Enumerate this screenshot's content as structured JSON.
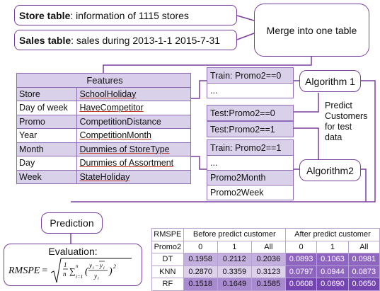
{
  "store_box": {
    "bold": "Store table",
    "rest": ": information of 1115 stores"
  },
  "sales_box": {
    "bold": "Sales table",
    "rest": ": sales during 2013-1-1 2015-7-31"
  },
  "merge_box": "Merge into one table",
  "features": {
    "header": "Features",
    "rows": [
      [
        "Store",
        "SchoolHoliday"
      ],
      [
        "Day of week",
        "HaveCompetitor"
      ],
      [
        "Promo",
        "CompetitionDistance"
      ],
      [
        "Year",
        "CompetitionMonth"
      ],
      [
        "Month",
        "Dummies of StoreType"
      ],
      [
        "Day",
        "Dummies of Assortment"
      ],
      [
        "Week",
        "StateHoliday"
      ]
    ]
  },
  "train1": {
    "label": "Train: Promo2==0",
    "sub": "..."
  },
  "test1": "Test:Promo2==0",
  "test2": "Test:Promo2==1",
  "train2": {
    "label": "Train: Promo2==1",
    "sub": "...",
    "f1": "Promo2Month",
    "f2": "Promo2Week"
  },
  "algorithm1": "Algorithm 1",
  "algorithm2": "Algorithm2",
  "predict_note": [
    "Predict",
    "Customers",
    "for test",
    "data"
  ],
  "prediction": "Prediction",
  "evaluation": {
    "title": "Evaluation:",
    "lhs": "RMSPE",
    "eq": "="
  },
  "results": {
    "corner": "RMSPE",
    "groups": [
      "Before predict customer",
      "After predict customer"
    ],
    "row_label": "Promo2",
    "cols": [
      "0",
      "1",
      "All",
      "0",
      "1",
      "All"
    ],
    "rows": [
      {
        "name": "DT",
        "values": [
          "0.1958",
          "0.2112",
          "0.2036",
          "0.0893",
          "0.1063",
          "0.0981"
        ]
      },
      {
        "name": "KNN",
        "values": [
          "0.2870",
          "0.3359",
          "0.3123",
          "0.0797",
          "0.0944",
          "0.0873"
        ]
      },
      {
        "name": "RF",
        "values": [
          "0.1518",
          "0.1649",
          "0.1585",
          "0.0608",
          "0.0690",
          "0.0650"
        ]
      }
    ]
  },
  "colors": {
    "border": "#7a3e9d",
    "light_purple": "#d9d0ea",
    "dark_purple": "#7445b0"
  }
}
